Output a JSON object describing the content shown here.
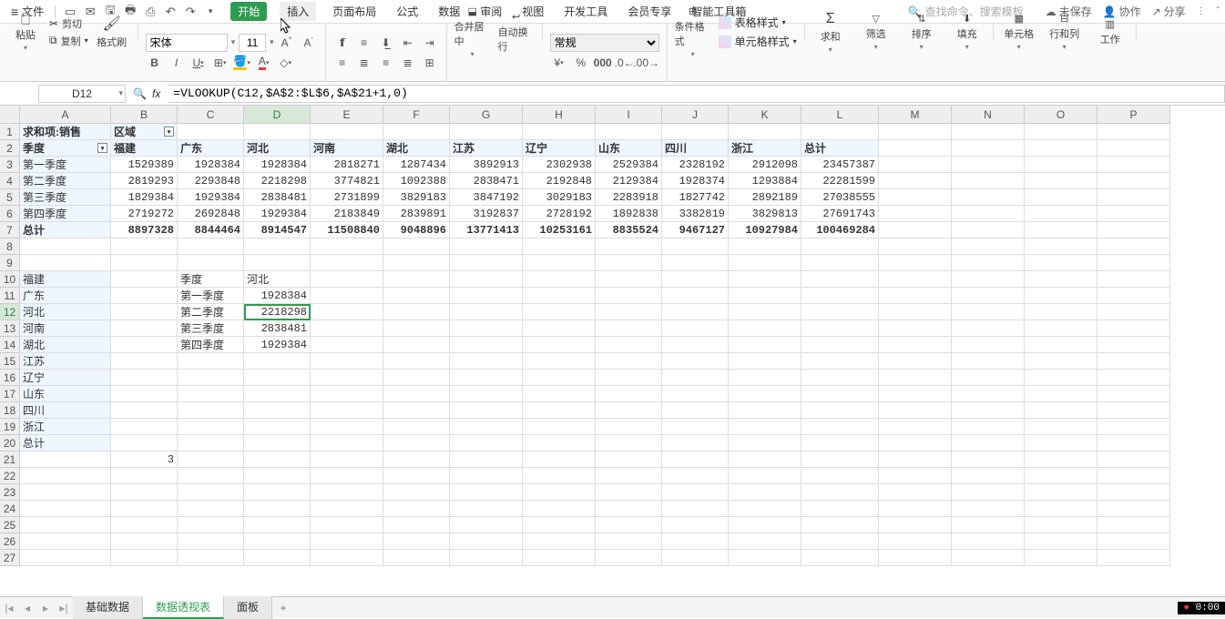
{
  "menubar": {
    "file": "文件",
    "tabs": [
      "开始",
      "插入",
      "页面布局",
      "公式",
      "数据",
      "审阅",
      "视图",
      "开发工具",
      "会员专享",
      "智能工具箱"
    ],
    "active_tab_index": 0,
    "hover_tab_index": 1,
    "search_placeholder": "查找命令、搜索模板",
    "unsaved": "未保存",
    "collab": "协作",
    "share": "分享"
  },
  "ribbon": {
    "paste": "粘贴",
    "cut": "剪切",
    "copy": "复制",
    "format_painter": "格式刷",
    "font_name": "宋体",
    "font_size": "11",
    "merge_center": "合并居中",
    "wrap": "自动换行",
    "number_format": "常规",
    "cond_format": "条件格式",
    "table_style": "表格样式",
    "cell_style": "单元格样式",
    "sum": "求和",
    "filter": "筛选",
    "sort": "排序",
    "fill": "填充",
    "cell": "单元格",
    "rowcol": "行和列",
    "worksheet": "工作"
  },
  "formulaBar": {
    "name_box": "D12",
    "formula": "=VLOOKUP(C12,$A$2:$L$6,$A$21+1,0)"
  },
  "columns": [
    "A",
    "B",
    "C",
    "D",
    "E",
    "F",
    "G",
    "H",
    "I",
    "J",
    "K",
    "L",
    "M",
    "N",
    "O",
    "P"
  ],
  "active_col": "D",
  "active_row": 12,
  "row_count": 27,
  "pivot": {
    "title": "求和项:销售",
    "col_label": "区域",
    "row_label": "季度",
    "col_headers": [
      "福建",
      "广东",
      "河北",
      "河南",
      "湖北",
      "江苏",
      "辽宁",
      "山东",
      "四川",
      "浙江",
      "总计"
    ],
    "rows": [
      {
        "label": "第一季度",
        "vals": [
          1529389,
          1928384,
          1928384,
          2818271,
          1287434,
          3892913,
          2302938,
          2529384,
          2328192,
          2912098,
          23457387
        ]
      },
      {
        "label": "第二季度",
        "vals": [
          2819293,
          2293848,
          2218298,
          3774821,
          1092388,
          2838471,
          2192848,
          2129384,
          1928374,
          1293884,
          22281599
        ]
      },
      {
        "label": "第三季度",
        "vals": [
          1829384,
          1929384,
          2838481,
          2731899,
          3829183,
          3847192,
          3029183,
          2283918,
          1827742,
          2892189,
          27038555
        ]
      },
      {
        "label": "第四季度",
        "vals": [
          2719272,
          2692848,
          1929384,
          2183849,
          2839891,
          3192837,
          2728192,
          1892838,
          3382819,
          3829813,
          27691743
        ]
      }
    ],
    "total_label": "总计",
    "totals": [
      8897328,
      8844464,
      8914547,
      11508840,
      9048896,
      13771413,
      10253161,
      8835524,
      9467127,
      10927984,
      100469284
    ]
  },
  "region_list": [
    "福建",
    "广东",
    "河北",
    "河南",
    "湖北",
    "江苏",
    "辽宁",
    "山东",
    "四川",
    "浙江",
    "总计"
  ],
  "region_list_extra_row": {
    "row": 21,
    "value": "3"
  },
  "lookup": {
    "header_c": "季度",
    "header_d": "河北",
    "rows": [
      {
        "c": "第一季度",
        "d": 1928384
      },
      {
        "c": "第二季度",
        "d": 2218298
      },
      {
        "c": "第三季度",
        "d": 2838481
      },
      {
        "c": "第四季度",
        "d": 1929384
      }
    ],
    "selected_row_index": 1
  },
  "sheet_tabs": {
    "tabs": [
      "基础数据",
      "数据透视表",
      "面板"
    ],
    "active_index": 1
  },
  "timer": "0:00"
}
